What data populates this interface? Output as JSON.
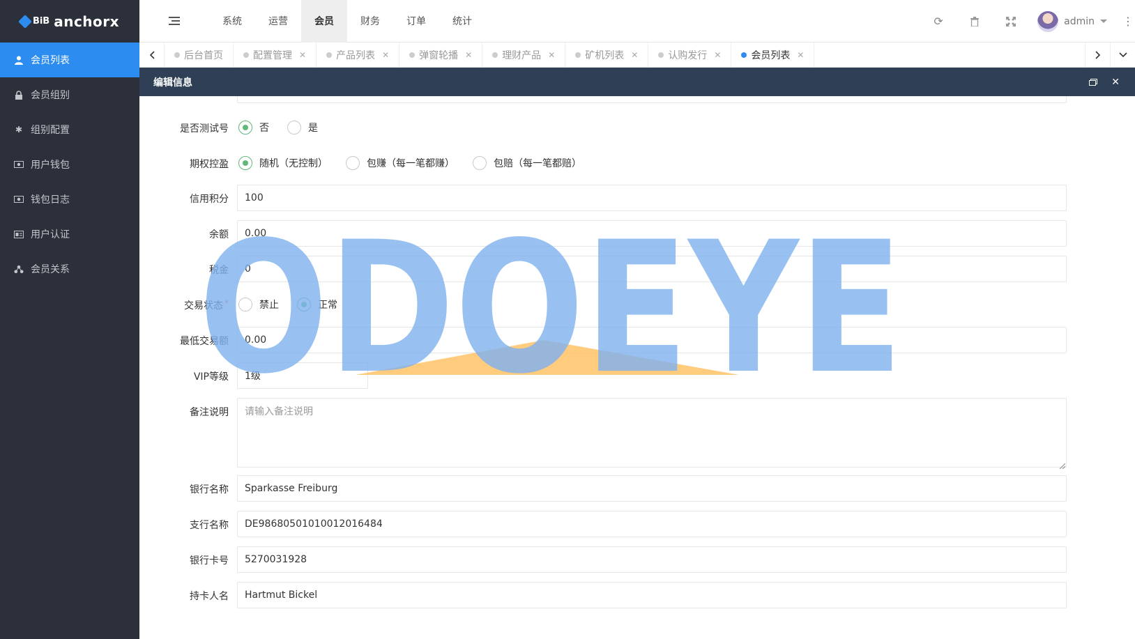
{
  "brand": {
    "logo_text": "BiB",
    "name": "anchorx"
  },
  "sidebar": {
    "items": [
      {
        "label": "会员列表",
        "icon": "user-icon",
        "active": true
      },
      {
        "label": "会员组别",
        "icon": "lock-icon",
        "active": false
      },
      {
        "label": "组别配置",
        "icon": "asterisk-icon",
        "active": false
      },
      {
        "label": "用户钱包",
        "icon": "money-icon",
        "active": false
      },
      {
        "label": "钱包日志",
        "icon": "money-icon",
        "active": false
      },
      {
        "label": "用户认证",
        "icon": "id-card-icon",
        "active": false
      },
      {
        "label": "会员关系",
        "icon": "share-icon",
        "active": false
      }
    ]
  },
  "topnav": {
    "items": [
      "系统",
      "运营",
      "会员",
      "财务",
      "订单",
      "统计"
    ],
    "active_index": 2
  },
  "user": {
    "name": "admin"
  },
  "tabs": [
    {
      "label": "后台首页",
      "closable": false,
      "active": false
    },
    {
      "label": "配置管理",
      "closable": true,
      "active": false
    },
    {
      "label": "产品列表",
      "closable": true,
      "active": false
    },
    {
      "label": "弹窗轮播",
      "closable": true,
      "active": false
    },
    {
      "label": "理财产品",
      "closable": true,
      "active": false
    },
    {
      "label": "矿机列表",
      "closable": true,
      "active": false
    },
    {
      "label": "认购发行",
      "closable": true,
      "active": false
    },
    {
      "label": "会员列表",
      "closable": true,
      "active": true
    }
  ],
  "panel": {
    "title": "编辑信息"
  },
  "form": {
    "test_account": {
      "label": "是否测试号",
      "options": [
        "否",
        "是"
      ],
      "selected": 0
    },
    "option_control": {
      "label": "期权控盈",
      "options": [
        "随机（无控制）",
        "包赚（每一笔都赚）",
        "包赔（每一笔都赔）"
      ],
      "selected": 0
    },
    "credit": {
      "label": "信用积分",
      "value": "100"
    },
    "balance": {
      "label": "余额",
      "value": "0.00"
    },
    "tax": {
      "label": "税金",
      "value": "0"
    },
    "trade_status": {
      "label": "交易状态",
      "required_mark": "*",
      "options": [
        "禁止",
        "正常"
      ],
      "selected": 1
    },
    "min_trade": {
      "label": "最低交易额",
      "value": "0.00"
    },
    "vip_level": {
      "label": "VIP等级",
      "value": "1级"
    },
    "remark": {
      "label": "备注说明",
      "placeholder": "请输入备注说明"
    },
    "bank_name": {
      "label": "银行名称",
      "value": "Sparkasse Freiburg"
    },
    "branch_name": {
      "label": "支行名称",
      "value": "DE98680501010012016484"
    },
    "card_number": {
      "label": "银行卡号",
      "value": "5270031928"
    },
    "holder_name": {
      "label": "持卡人名",
      "value": "Hartmut Bickel"
    }
  },
  "watermark": {
    "text": "ODOEYE",
    "color": "#7fb2f0",
    "accent": "#ffc266"
  },
  "colors": {
    "sidebar_bg": "#2b303b",
    "active_blue": "#2d8cf0",
    "panel_head": "#2f4056",
    "radio_green": "#5fb878"
  }
}
